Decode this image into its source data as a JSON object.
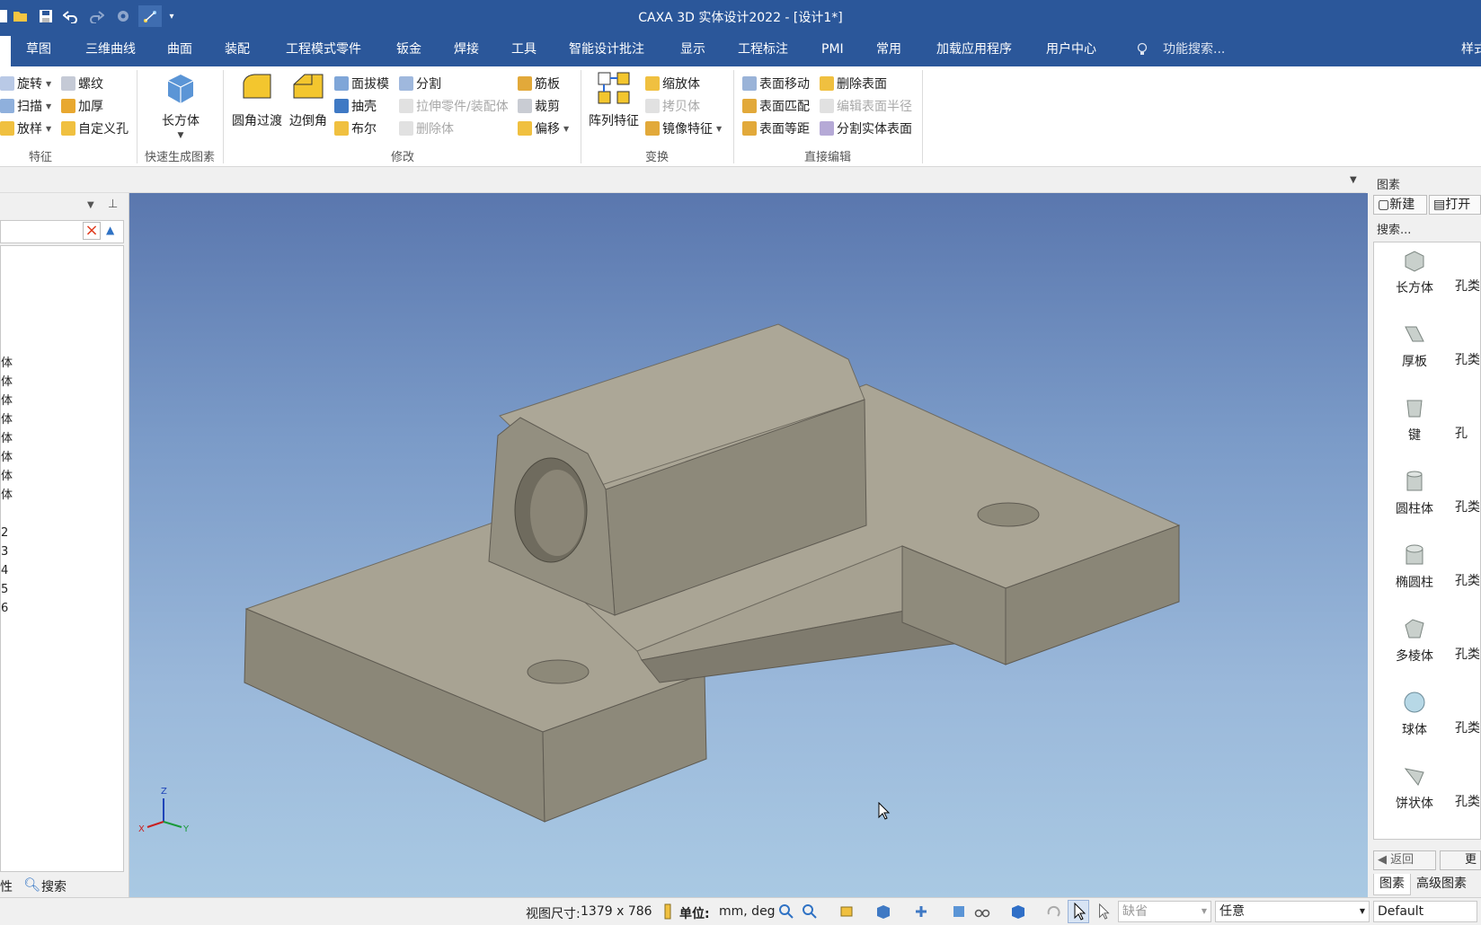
{
  "window": {
    "title": "CAXA 3D 实体设计2022 - [设计1*]"
  },
  "menu": {
    "tabs": [
      "草图",
      "三维曲线",
      "曲面",
      "装配",
      "工程模式零件",
      "钣金",
      "焊接",
      "工具",
      "智能设计批注",
      "显示",
      "工程标注",
      "PMI",
      "常用",
      "加载应用程序",
      "用户中心"
    ],
    "search_placeholder": "功能搜索...",
    "right_label": "样式"
  },
  "ribbon": {
    "feature": {
      "label": "特征",
      "items": [
        "旋转",
        "扫描",
        "放样",
        "螺纹",
        "加厚",
        "自定义孔"
      ]
    },
    "quick": {
      "label": "快速生成图素",
      "big": "长方体"
    },
    "modify": {
      "label": "修改",
      "big": [
        "圆角过渡",
        "边倒角"
      ],
      "col1": [
        "面拔模",
        "抽壳",
        "布尔"
      ],
      "col2": [
        "分割",
        "拉伸零件/装配体",
        "删除体"
      ],
      "col3": [
        "筋板",
        "裁剪",
        "偏移"
      ]
    },
    "transform": {
      "label": "变换",
      "big": "阵列特征",
      "col": [
        "缩放体",
        "拷贝体",
        "镜像特征"
      ]
    },
    "direct": {
      "label": "直接编辑",
      "col1": [
        "表面移动",
        "表面匹配",
        "表面等距"
      ],
      "col2": [
        "删除表面",
        "编辑表面半径",
        "分割实体表面"
      ]
    }
  },
  "left_panel": {
    "tree_items": [
      "体",
      "体",
      "体",
      "体",
      "体",
      "体",
      "体",
      "体",
      "2",
      "3",
      "4",
      "5",
      "6"
    ],
    "bottom_tabs": [
      "性",
      "搜索"
    ]
  },
  "right_panel": {
    "title": "图素",
    "buttons": [
      "新建",
      "打开"
    ],
    "search_label": "搜索...",
    "items": [
      "长方体",
      "厚板",
      "键",
      "圆柱体",
      "椭圆柱",
      "多棱体",
      "球体",
      "饼状体"
    ],
    "items_col2": [
      "孔类",
      "孔类",
      "孔",
      "孔类",
      "孔类",
      "孔类",
      "孔类",
      "孔类"
    ],
    "nav": [
      "返回",
      "更"
    ],
    "tabs": [
      "图素",
      "高级图素"
    ]
  },
  "axes": {
    "x": "X",
    "y": "Y",
    "z": "Z"
  },
  "status": {
    "view_size_label": "视图尺寸:",
    "view_size_value": "1379 x  786",
    "unit_label": "单位:",
    "unit_value": "mm, deg",
    "combo1": "缺省",
    "combo2": "任意",
    "combo3": "Default"
  },
  "colors": {
    "brand_blue": "#2b579a",
    "part_color": "#a19c8c",
    "viewport_top": "#5a77ae",
    "viewport_bottom": "#a9c9e3"
  }
}
